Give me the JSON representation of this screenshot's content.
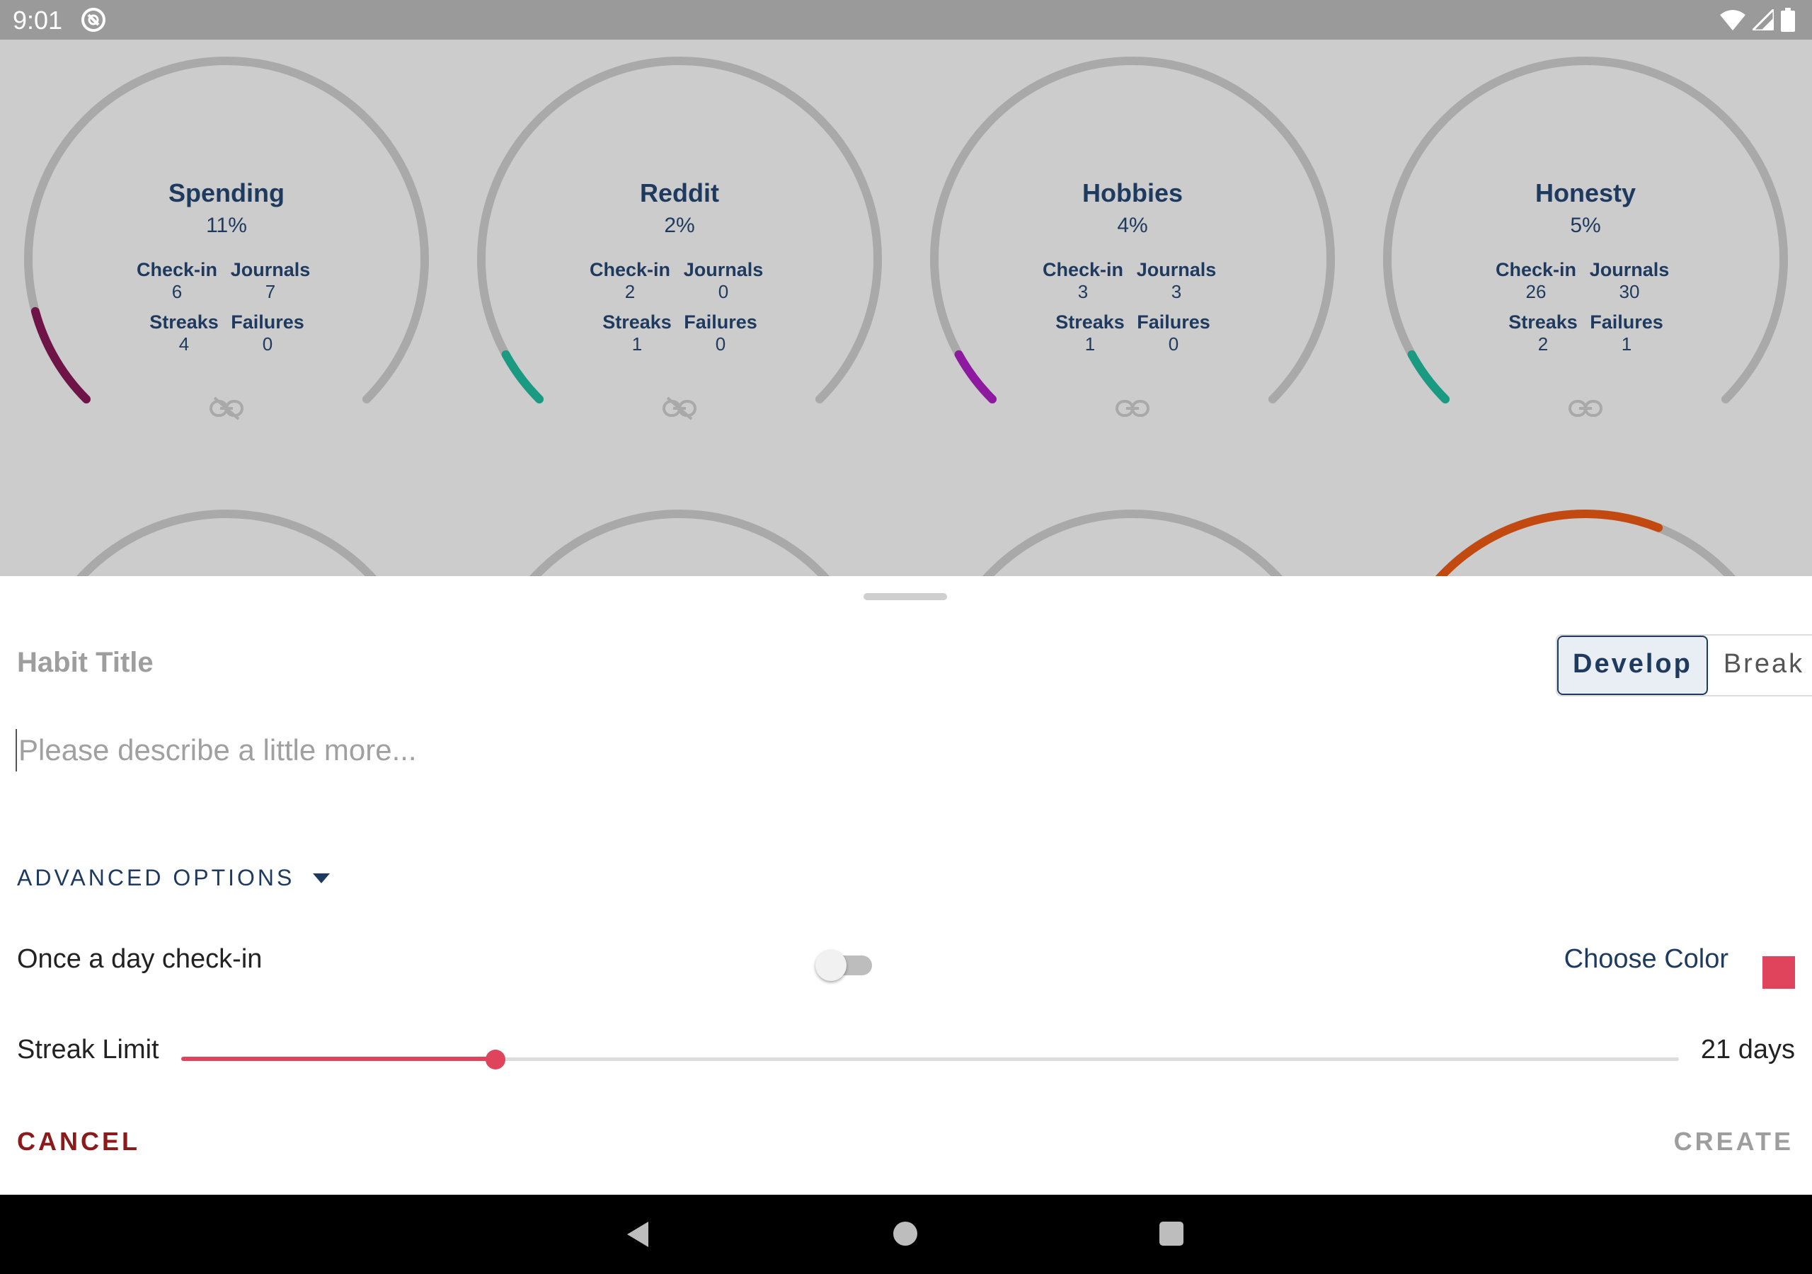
{
  "status_bar": {
    "time": "9:01",
    "icons": [
      "app-notification-icon",
      "wifi-icon",
      "signal-icon",
      "battery-icon"
    ]
  },
  "gauges": [
    {
      "title": "Spending",
      "percent": "11%",
      "checkin_label": "Check-in",
      "journals_label": "Journals",
      "streaks_label": "Streaks",
      "failures_label": "Failures",
      "checkin": "6",
      "journals": "7",
      "streaks": "4",
      "failures": "0",
      "color": "#6e1446",
      "progress": 0.11,
      "link_icon": "link-broken-icon"
    },
    {
      "title": "Reddit",
      "percent": "2%",
      "checkin_label": "Check-in",
      "journals_label": "Journals",
      "streaks_label": "Streaks",
      "failures_label": "Failures",
      "checkin": "2",
      "journals": "0",
      "streaks": "1",
      "failures": "0",
      "color": "#1a9a80",
      "progress": 0.02,
      "link_icon": "link-broken-icon"
    },
    {
      "title": "Hobbies",
      "percent": "4%",
      "checkin_label": "Check-in",
      "journals_label": "Journals",
      "streaks_label": "Streaks",
      "failures_label": "Failures",
      "checkin": "3",
      "journals": "3",
      "streaks": "1",
      "failures": "0",
      "color": "#8e1aa0",
      "progress": 0.04,
      "link_icon": "link-icon"
    },
    {
      "title": "Honesty",
      "percent": "5%",
      "checkin_label": "Check-in",
      "journals_label": "Journals",
      "streaks_label": "Streaks",
      "failures_label": "Failures",
      "checkin": "26",
      "journals": "30",
      "streaks": "2",
      "failures": "1",
      "color": "#1a9a80",
      "progress": 0.05,
      "link_icon": "link-icon"
    }
  ],
  "gauges_row2": [
    {
      "color": ""
    },
    {
      "color": "#0e4a3e"
    },
    {
      "color": ""
    },
    {
      "color": "#c24a10"
    }
  ],
  "form": {
    "habit_title_placeholder": "Habit Title",
    "type_options": [
      "Develop",
      "Break"
    ],
    "type_selected": "Develop",
    "description_placeholder": "Please describe a little more...",
    "advanced_options_label": "ADVANCED OPTIONS",
    "once_a_day_label": "Once a day check-in",
    "once_a_day_enabled": false,
    "choose_color_label": "Choose Color",
    "selected_color": "#e0445c",
    "streak_limit_label": "Streak Limit",
    "streak_limit_value": "21 days",
    "streak_slider_fraction": 0.21,
    "cancel_label": "CANCEL",
    "create_label": "CREATE"
  },
  "nav": {
    "icons": [
      "back-icon",
      "home-icon",
      "recents-icon"
    ]
  }
}
